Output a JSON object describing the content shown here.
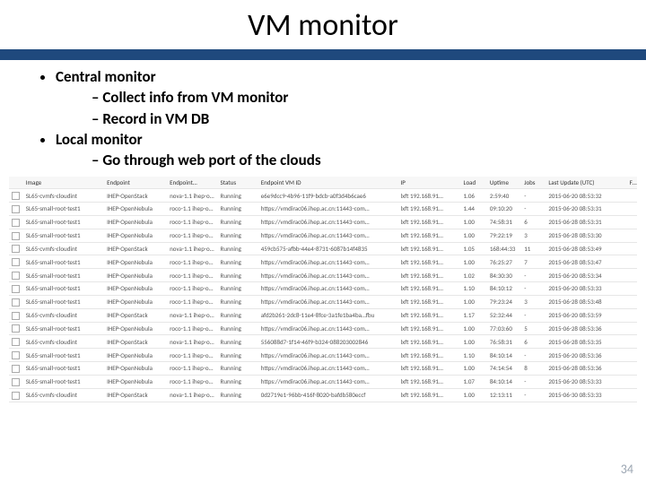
{
  "title": "VM monitor",
  "bullets": {
    "b1": "Central monitor",
    "b1a": "Collect info from VM monitor",
    "b1b": "Record in VM DB",
    "b2": "Local monitor",
    "b2a": "Go through web port of the clouds"
  },
  "headers": {
    "h0": "",
    "h1": "Image",
    "h2": "Endpoint",
    "h3": "Endpoint…",
    "h4": "Status",
    "h5": "Endpoint VM ID",
    "h6": "IP",
    "h7": "Load",
    "h8": "Uptime",
    "h9": "Jobs",
    "h10": "Last Update (UTC)",
    "h11": "Fr…"
  },
  "rows": [
    {
      "img": "SL65-cvmfs-cloudint",
      "ep": "IHEP-OpenStack",
      "epi": "nova-1.1 ihep-o…",
      "st": "Running",
      "vmid": "e6e9dcc9-4b96-11f9-bdcb-a0f3d4b6cae6",
      "ip": "lxft 192.168.91…",
      "load": "1.06",
      "up": "2:59:40",
      "jobs": "-",
      "upd": "2015-06-20 08:53:32"
    },
    {
      "img": "SL65-small-root-test1",
      "ep": "IHEP-OpenNebula",
      "epi": "roco-1.1 ihep-o…",
      "st": "Running",
      "vmid": "https://vmdirac06.ihep.ac.cn:11443-com…",
      "ip": "lxft 192.168.91…",
      "load": "1.44",
      "up": "09:10:20",
      "jobs": "-",
      "upd": "2015-06-20 08:53:31"
    },
    {
      "img": "SL65-small-root-test1",
      "ep": "IHEP-OpenNebula",
      "epi": "roco-1.1 ihep-o…",
      "st": "Running",
      "vmid": "https://vmdirac06.ihep.ac.cn:11443-com…",
      "ip": "lxft 192.168.91…",
      "load": "1.00",
      "up": "74:58:31",
      "jobs": "6",
      "upd": "2015-06-28 08:53:31"
    },
    {
      "img": "SL65-small-root-test1",
      "ep": "IHEP-OpenNebula",
      "epi": "roco-1.1 ihep-o…",
      "st": "Running",
      "vmid": "https://vmdirac06.ihep.ac.cn:11443-com…",
      "ip": "lxft 192.168.91…",
      "load": "1.00",
      "up": "79:22:19",
      "jobs": "3",
      "upd": "2015-06-28 08:53:30"
    },
    {
      "img": "SL65-cvmfs-cloudint",
      "ep": "IHEP-OpenStack",
      "epi": "nova-1.1 ihep-o…",
      "st": "Running",
      "vmid": "459cb575-afbb-44e4-8731-6087b14f4835",
      "ip": "lxft 192.168.91…",
      "load": "1.05",
      "up": "168:44:33",
      "jobs": "11",
      "upd": "2015-06-28 08:53:49"
    },
    {
      "img": "SL65-small-root-test1",
      "ep": "IHEP-OpenNebula",
      "epi": "roco-1.1 ihep-o…",
      "st": "Running",
      "vmid": "https://vmdirac06.ihep.ac.cn:11443-com…",
      "ip": "lxft 192.168.91…",
      "load": "1.00",
      "up": "76:25:27",
      "jobs": "7",
      "upd": "2015-06-28 08:53:47"
    },
    {
      "img": "SL65-small-root-test1",
      "ep": "IHEP-OpenNebula",
      "epi": "roco-1.1 ihep-o…",
      "st": "Running",
      "vmid": "https://vmdirac06.ihep.ac.cn:11443-com…",
      "ip": "lxft 192.168.91…",
      "load": "1.02",
      "up": "84:30:30",
      "jobs": "-",
      "upd": "2015-06-20 08:53:34"
    },
    {
      "img": "SL65-small-root-test1",
      "ep": "IHEP-OpenNebula",
      "epi": "roco-1.1 ihep-o…",
      "st": "Running",
      "vmid": "https://vmdirac06.ihep.ac.cn:11443-com…",
      "ip": "lxft 192.168.91…",
      "load": "1.10",
      "up": "84:10:12",
      "jobs": "-",
      "upd": "2015-06-20 08:53:33"
    },
    {
      "img": "SL65-small-root-test1",
      "ep": "IHEP-OpenNebula",
      "epi": "roco-1.1 ihep-o…",
      "st": "Running",
      "vmid": "https://vmdirac06.ihep.ac.cn:11443-com…",
      "ip": "lxft 192.168.91…",
      "load": "1.00",
      "up": "79:23:24",
      "jobs": "3",
      "upd": "2015-06-28 08:53:48"
    },
    {
      "img": "SL65-cvmfs-cloudint",
      "ep": "IHEP-OpenStack",
      "epi": "nova-1.1 ihep-o…",
      "st": "Running",
      "vmid": "afd2b261-2dc8-11e4-8fce-3a1fe1ba4ba…fbu",
      "ip": "lxft 192.168.91…",
      "load": "1.17",
      "up": "52:32:44",
      "jobs": "-",
      "upd": "2015-06-20 08:53:59"
    },
    {
      "img": "SL65-small-root-test1",
      "ep": "IHEP-OpenNebula",
      "epi": "roco-1.1 ihep-o…",
      "st": "Running",
      "vmid": "https://vmdirac06.ihep.ac.cn:11443-com…",
      "ip": "lxft 192.168.91…",
      "load": "1.00",
      "up": "77:03:60",
      "jobs": "5",
      "upd": "2015-06-28 08:53:36"
    },
    {
      "img": "SL65-cvmfs-cloudint",
      "ep": "IHEP-OpenStack",
      "epi": "nova-1.1 ihep-o…",
      "st": "Running",
      "vmid": "556088d7-1f14-46f9-b324-088203002846",
      "ip": "lxft 192.168.91…",
      "load": "1.00",
      "up": "76:58:31",
      "jobs": "6",
      "upd": "2015-06-28 08:53:35"
    },
    {
      "img": "SL65-small-root-test1",
      "ep": "IHEP-OpenNebula",
      "epi": "roco-1.1 ihep-o…",
      "st": "Running",
      "vmid": "https://vmdirac06.ihep.ac.cn:11443-com…",
      "ip": "lxft 192.168.91…",
      "load": "1.10",
      "up": "84:10:14",
      "jobs": "-",
      "upd": "2015-06-20 08:53:36"
    },
    {
      "img": "SL65-small-root-test1",
      "ep": "IHEP-OpenNebula",
      "epi": "roco-1.1 ihep-o…",
      "st": "Running",
      "vmid": "https://vmdirac06.ihep.ac.cn:11443-com…",
      "ip": "lxft 192.168.91…",
      "load": "1.00",
      "up": "74:14:54",
      "jobs": "8",
      "upd": "2015-06-28 08:53:36"
    },
    {
      "img": "SL65-small-root-test1",
      "ep": "IHEP-OpenNebula",
      "epi": "roco-1.1 ihep-o…",
      "st": "Running",
      "vmid": "https://vmdirac06.ihep.ac.cn:11443-com…",
      "ip": "lxft 192.168.91…",
      "load": "1.07",
      "up": "84:10:14",
      "jobs": "-",
      "upd": "2015-06-20 08:53:33"
    },
    {
      "img": "SL65-cvmfs-cloudint",
      "ep": "IHEP-OpenStack",
      "epi": "nova-1.1 ihep-o…",
      "st": "Running",
      "vmid": "0d2719e1-96bb-416f-8020-bafdb580eccf",
      "ip": "lxft 192.168.91…",
      "load": "1.00",
      "up": "12:13:11",
      "jobs": "-",
      "upd": "2015-06-30 08:53:33"
    }
  ],
  "page": "34"
}
